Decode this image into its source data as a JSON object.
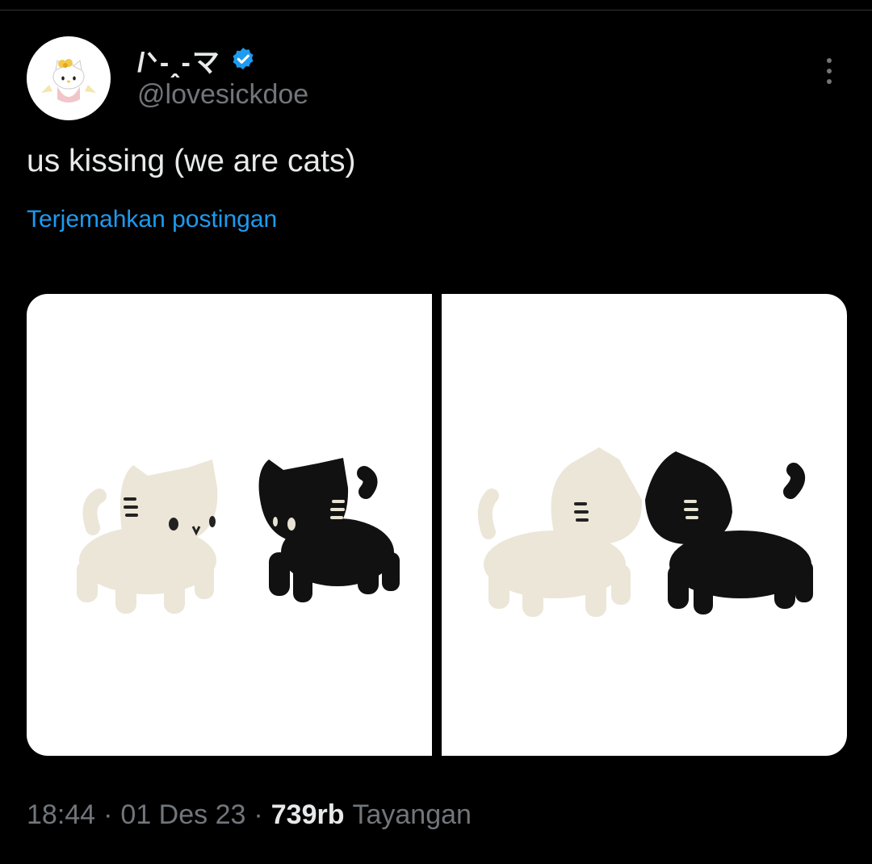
{
  "author": {
    "display_name": "/ᐠ-ꞈ-マ",
    "handle": "@lovesickdoe",
    "verified": true,
    "avatar": "hello-kitty-angel"
  },
  "post": {
    "text": "us kissing (we are cats)",
    "translate_label": "Terjemahkan postingan"
  },
  "media": [
    {
      "alt": "cream ceramic cat and black ceramic cat standing apart"
    },
    {
      "alt": "cream ceramic cat and black ceramic cat kissing"
    }
  ],
  "meta": {
    "time": "18:44",
    "separator": "·",
    "date": "01 Des 23",
    "views_count": "739rb",
    "views_label": "Tayangan"
  },
  "colors": {
    "background": "#000000",
    "text": "#e7e9ea",
    "secondary": "#71767b",
    "link": "#1d9bf0",
    "verified": "#1d9bf0"
  }
}
